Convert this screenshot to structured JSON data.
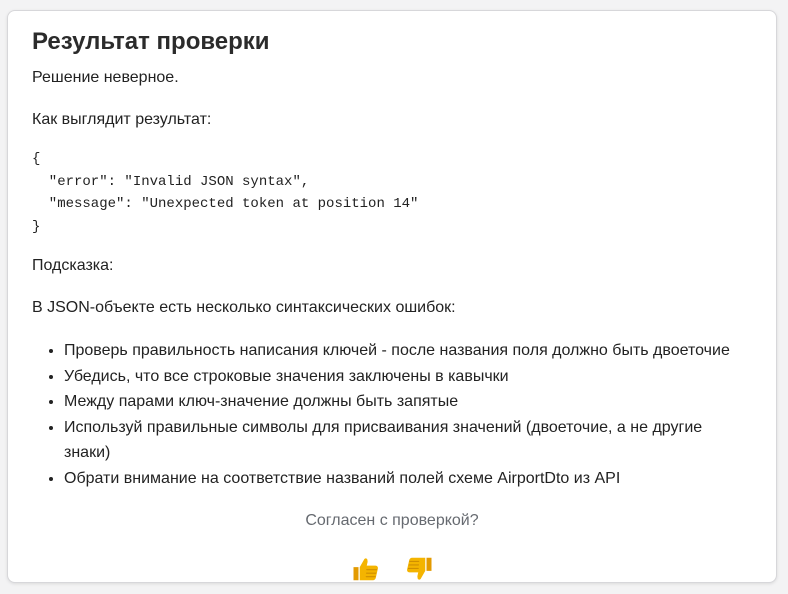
{
  "card": {
    "title": "Результат проверки",
    "status": "Решение неверное.",
    "result_label": "Как выглядит результат:",
    "result_code": "{\n  \"error\": \"Invalid JSON syntax\",\n  \"message\": \"Unexpected token at position 14\"\n}",
    "hint_label": "Подсказка:",
    "hint_intro": "В JSON-объекте есть несколько синтаксических ошибок:",
    "hints": [
      "Проверь правильность написания ключей - после названия поля должно быть двоеточие",
      "Убедись, что все строковые значения заключены в кавычки",
      "Между парами ключ-значение должны быть запятые",
      "Используй правильные символы для присваивания значений (двоеточие, а не другие знаки)",
      "Обрати внимание на соответствие названий полей схеме AirportDto из API"
    ]
  },
  "feedback": {
    "question": "Согласен с проверкой?",
    "thumbs_up_icon": "thumbs-up-icon",
    "thumbs_down_icon": "thumbs-down-icon",
    "icon_color": "#f4b400"
  },
  "colors": {
    "card_background": "#ffffff",
    "page_background": "#f3f3f4",
    "muted_text": "#666a70"
  }
}
